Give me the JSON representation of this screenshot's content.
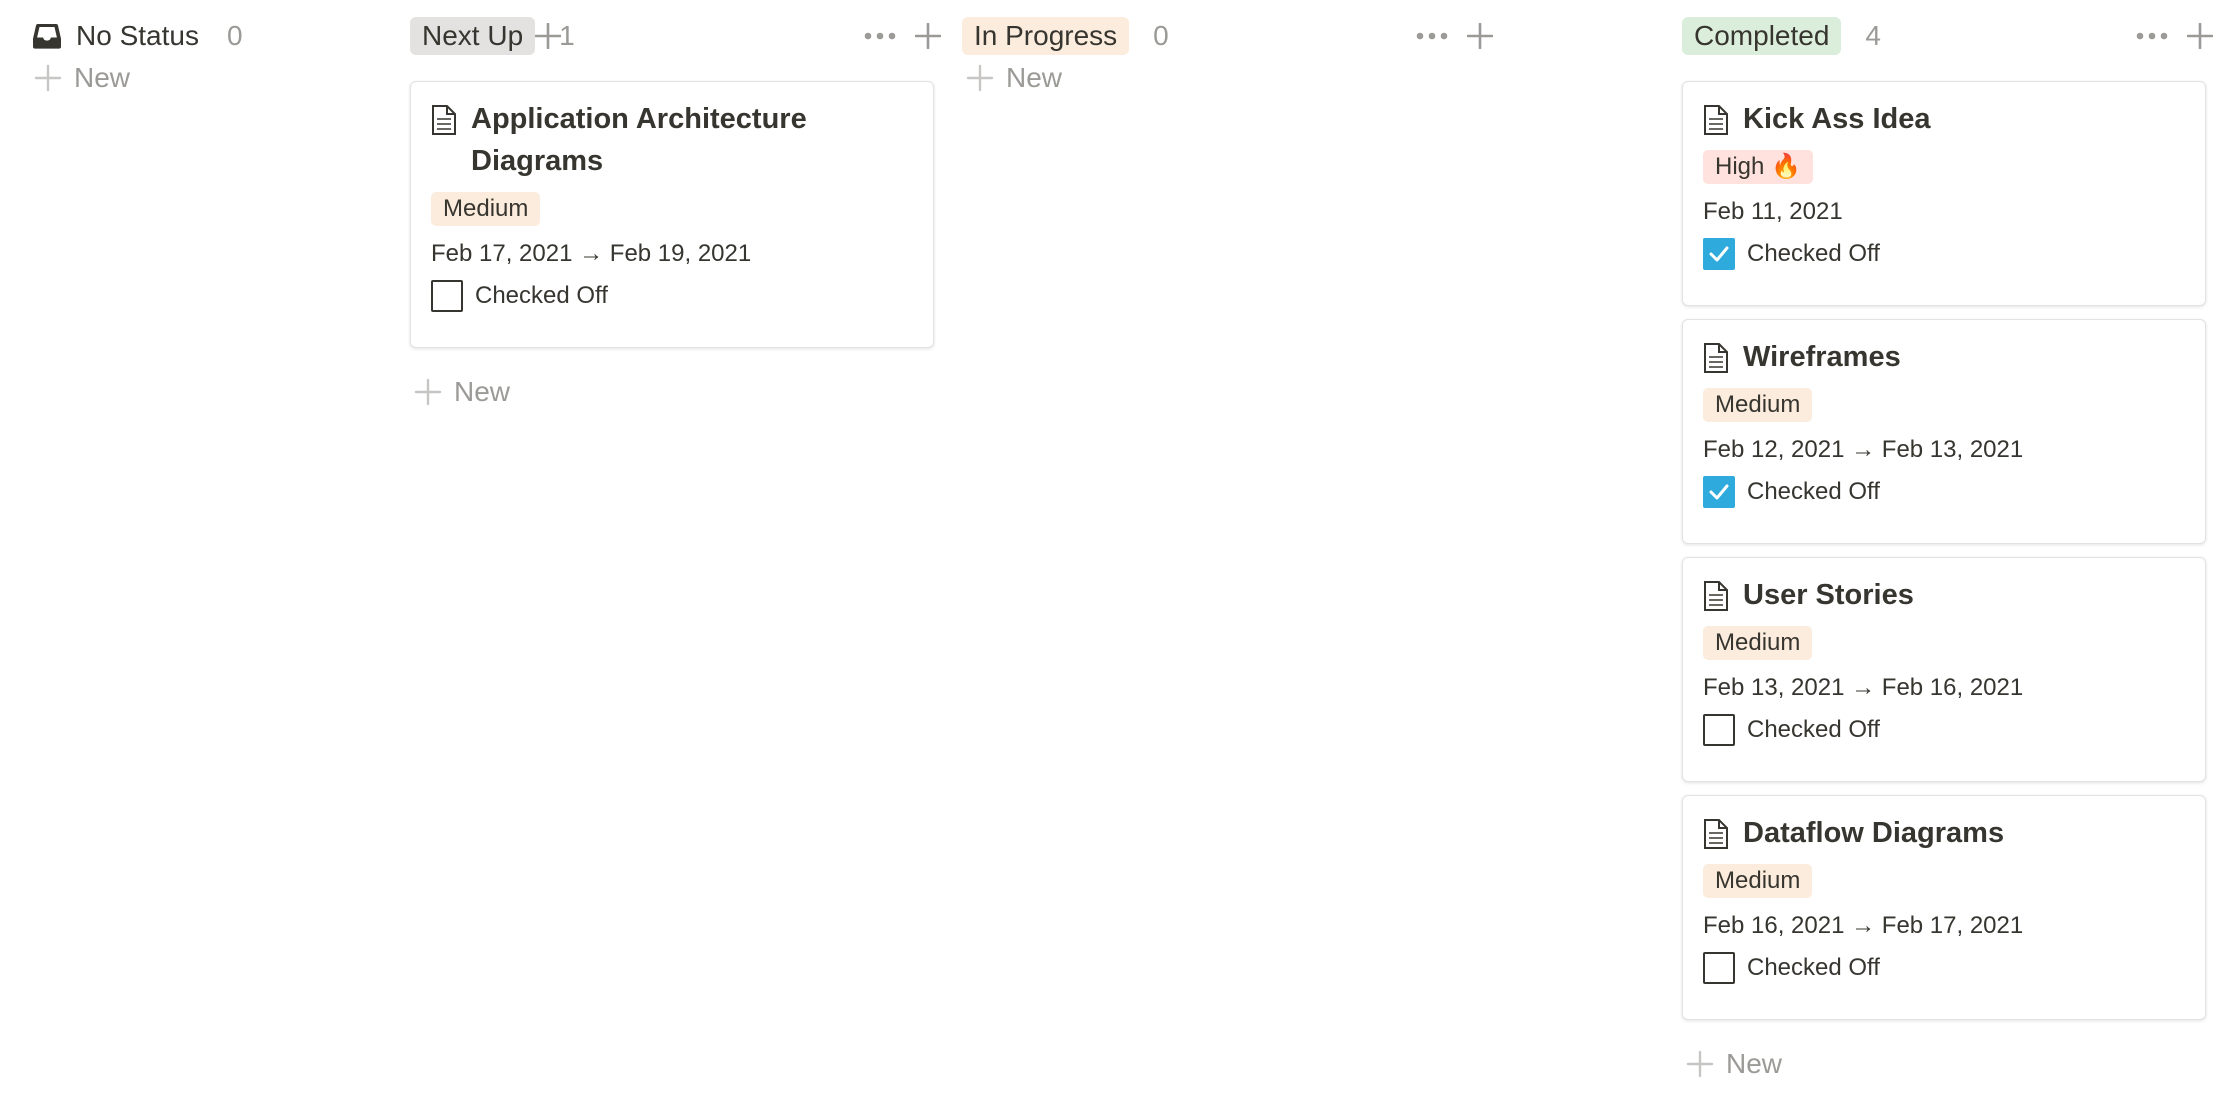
{
  "colors": {
    "text": "#37352f",
    "muted": "#9b9a97",
    "checkbox_checked": "#2eaadc",
    "tag_medium_bg": "#fbecdd",
    "tag_high_bg": "#ffe2dd",
    "next_up_bg": "#e3e2e0",
    "in_progress_bg": "#fbecdd",
    "completed_bg": "#dbeddb"
  },
  "columns": [
    {
      "title": "No Status",
      "count": "0",
      "icon": "inbox-icon",
      "new_label": "New",
      "cards": []
    },
    {
      "title": "Next Up",
      "count": "1",
      "new_label": "New",
      "cards": [
        {
          "title": "Application Architecture Diagrams",
          "priority": "Medium",
          "date": "Feb 17, 2021 → Feb 19, 2021",
          "checked": false,
          "check_label": "Checked Off"
        }
      ]
    },
    {
      "title": "In Progress",
      "count": "0",
      "new_label": "New",
      "cards": []
    },
    {
      "title": "Completed",
      "count": "4",
      "new_label": "New",
      "cards": [
        {
          "title": "Kick Ass Idea",
          "priority": "High 🔥",
          "date": "Feb 11, 2021",
          "checked": true,
          "check_label": "Checked Off"
        },
        {
          "title": "Wireframes",
          "priority": "Medium",
          "date": "Feb 12, 2021 → Feb 13, 2021",
          "checked": true,
          "check_label": "Checked Off"
        },
        {
          "title": "User Stories",
          "priority": "Medium",
          "date": "Feb 13, 2021 → Feb 16, 2021",
          "checked": false,
          "check_label": "Checked Off"
        },
        {
          "title": "Dataflow Diagrams",
          "priority": "Medium",
          "date": "Feb 16, 2021 → Feb 17, 2021",
          "checked": false,
          "check_label": "Checked Off"
        }
      ]
    }
  ]
}
